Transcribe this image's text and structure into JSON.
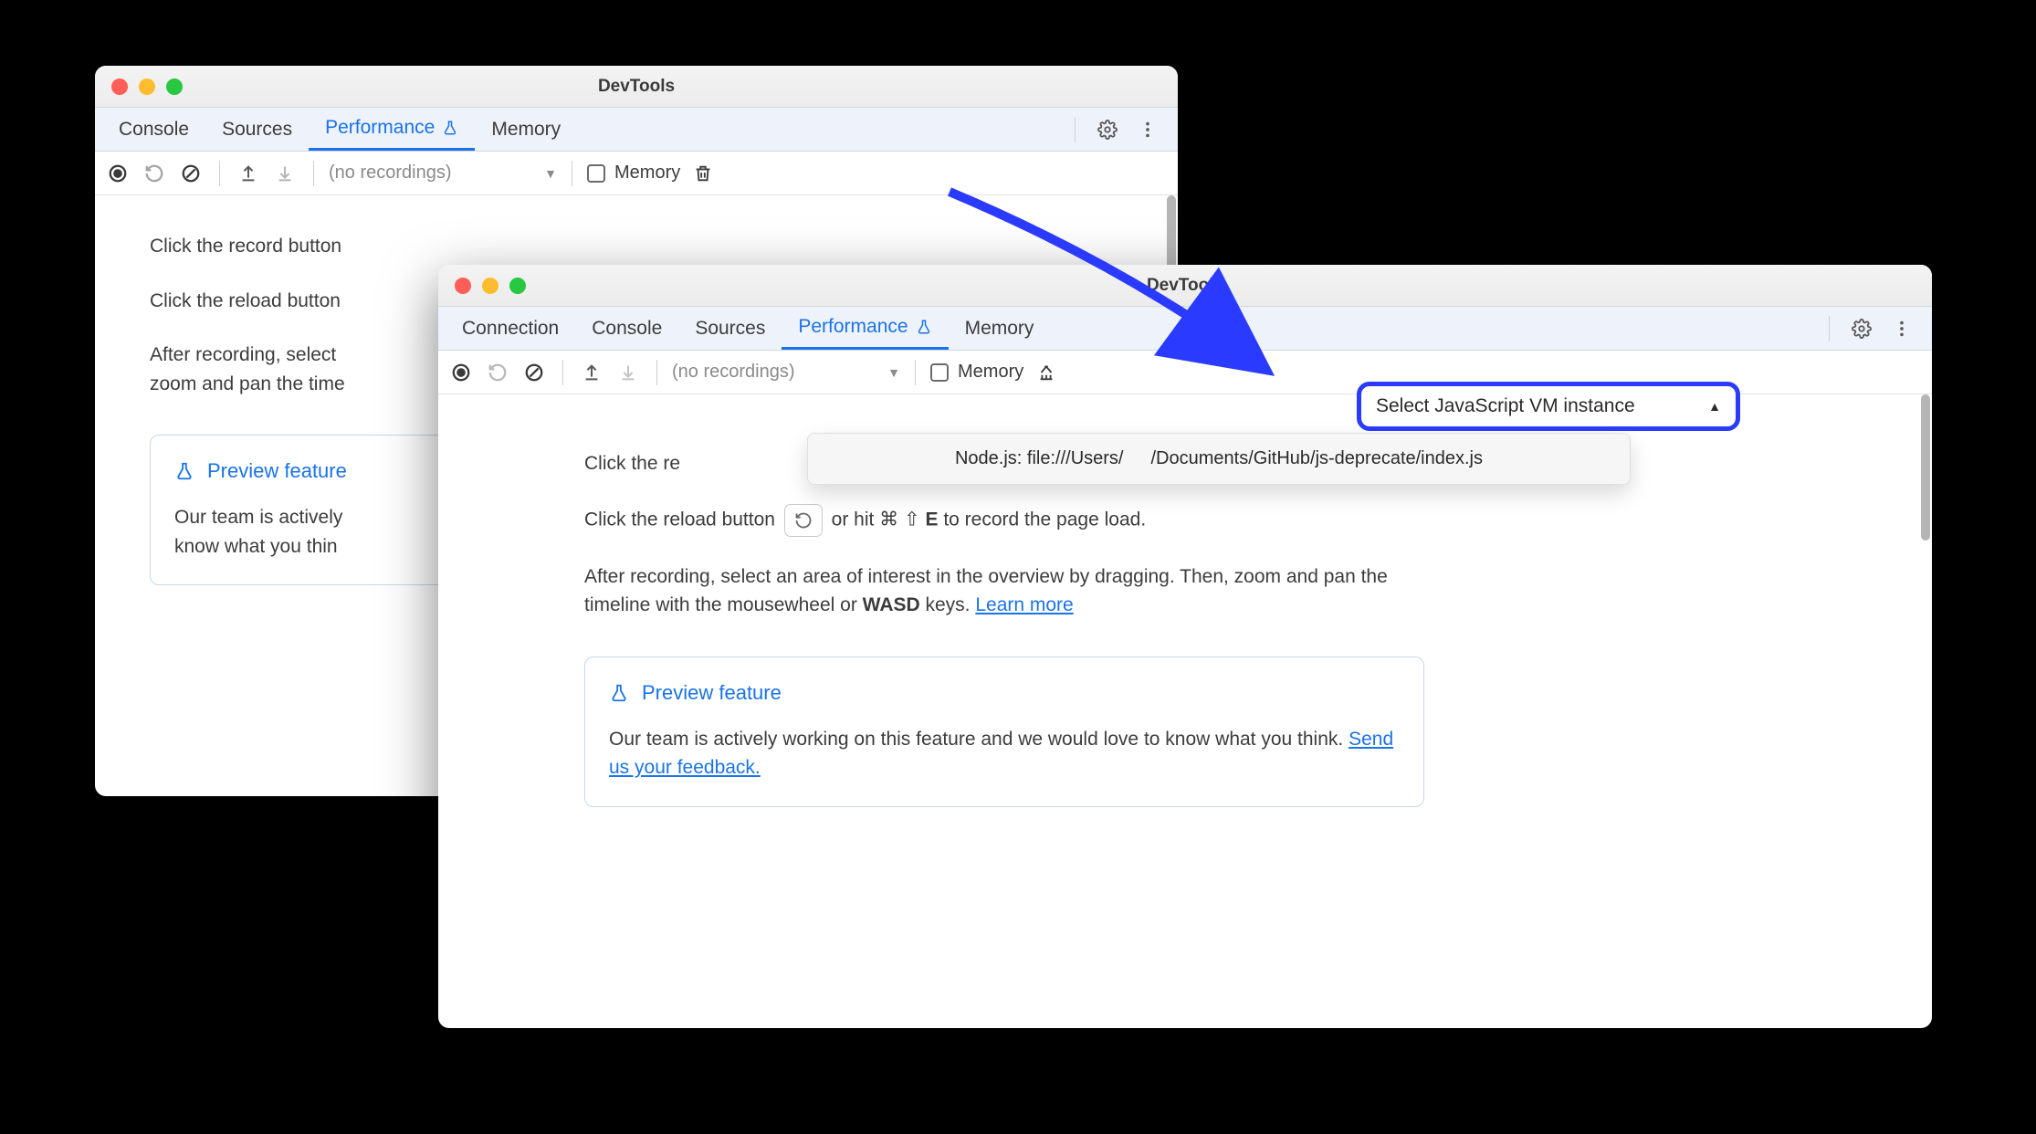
{
  "annotation": {
    "color": "#2a3bff"
  },
  "window1": {
    "title": "DevTools",
    "tabs": {
      "items": [
        "Console",
        "Sources",
        "Performance",
        "Memory"
      ],
      "active_index": 2
    },
    "toolbar": {
      "recordings_placeholder": "(no recordings)",
      "memory_label": "Memory"
    },
    "content": {
      "line1_a": "Click the record button",
      "line2_a": "Click the reload button",
      "line3_a": "After recording, select",
      "line3_b": "zoom and pan the time",
      "preview_title": "Preview feature",
      "preview_body_a": "Our team is actively",
      "preview_body_b": "know what you thin"
    }
  },
  "window2": {
    "title": "DevTools",
    "tabs": {
      "items": [
        "Connection",
        "Console",
        "Sources",
        "Performance",
        "Memory"
      ],
      "active_index": 3
    },
    "toolbar": {
      "recordings_placeholder": "(no recordings)",
      "memory_label": "Memory",
      "vm_select_label": "Select JavaScript VM instance",
      "vm_dropdown_item_a": "Node.js: file:///Users/",
      "vm_dropdown_item_b": "/Documents/GitHub/js-deprecate/index.js"
    },
    "content": {
      "line1_a": "Click the re",
      "line2_a": "Click the reload button ",
      "line2_b": " or hit ",
      "line2_key_cmd": "⌘",
      "line2_key_shift": "⇧",
      "line2_key_e": "E",
      "line2_c": " to record the page load.",
      "line3_a": "After recording, select an area of interest in the overview by dragging. Then, zoom and pan the timeline with the mousewheel or ",
      "line3_wasd": "WASD",
      "line3_b": " keys. ",
      "learn_more": "Learn more",
      "preview_title": "Preview feature",
      "preview_body_a": "Our team is actively working on this feature and we would love to know what you think. ",
      "preview_feedback": "Send us your feedback."
    }
  }
}
